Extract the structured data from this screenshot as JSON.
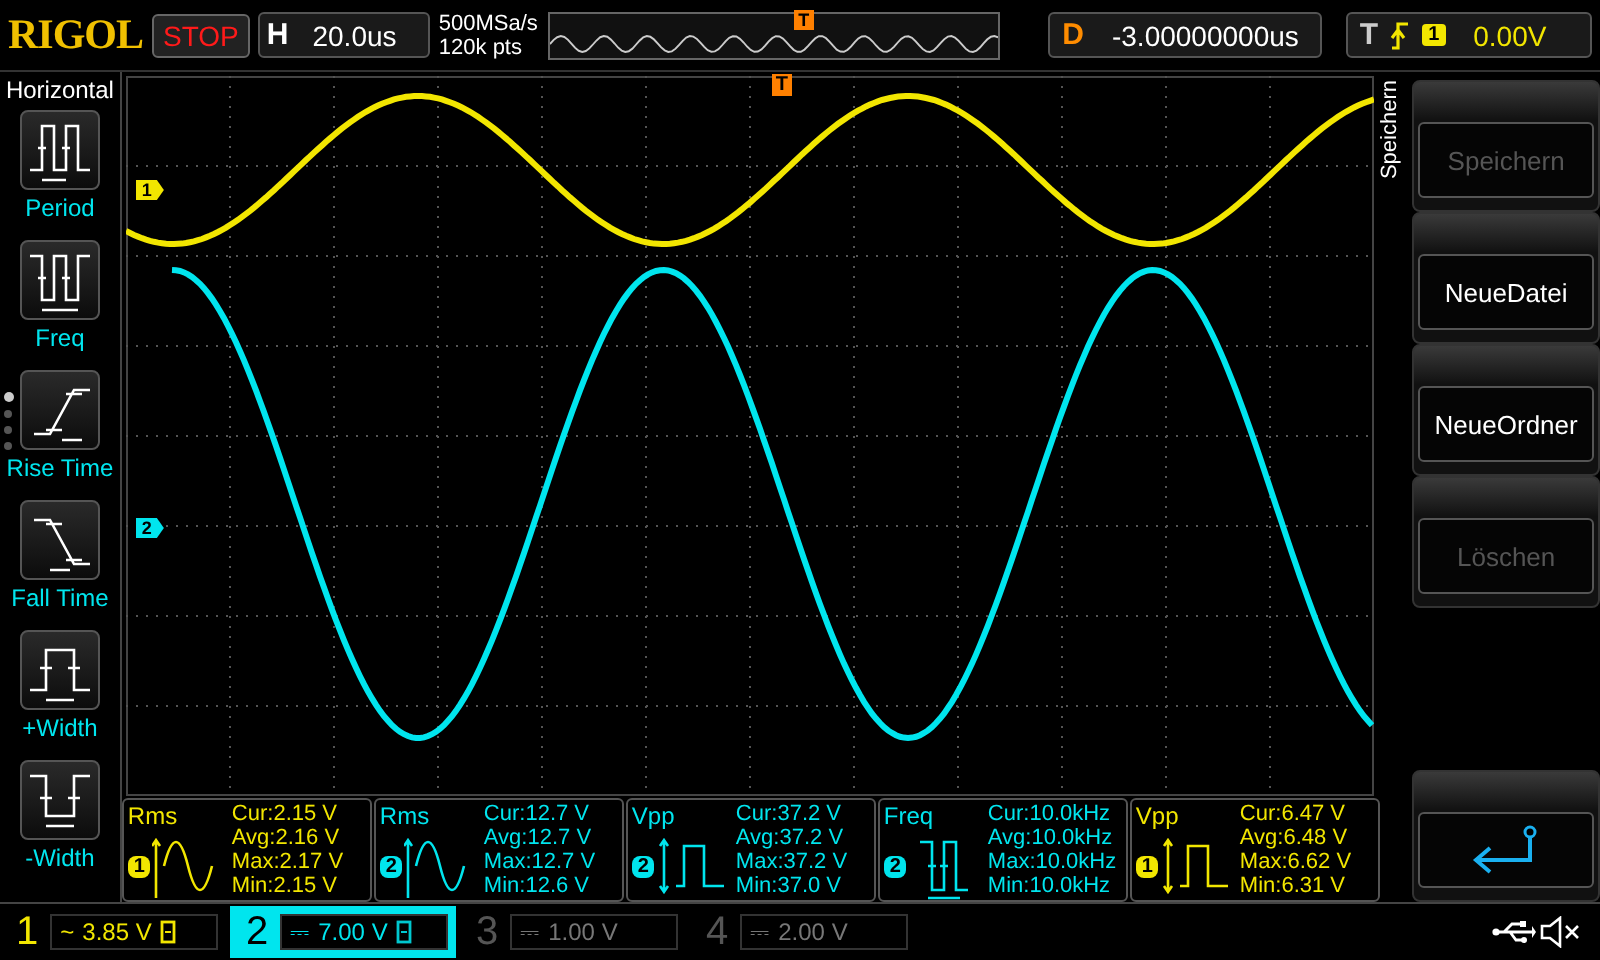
{
  "top_bar": {
    "logo": "RIGOL",
    "run_state": "STOP",
    "timebase": {
      "label": "H",
      "value": "20.0us"
    },
    "sample_rate": "500MSa/s",
    "memory_depth": "120k pts",
    "trigger_marker": "T",
    "delay": {
      "label": "D",
      "value": "-3.00000000us"
    },
    "trigger": {
      "label": "T",
      "source": "1",
      "level": "0.00V"
    }
  },
  "left_menu": {
    "title": "Horizontal",
    "page_dots": [
      {
        "selected": true
      },
      {
        "selected": false
      },
      {
        "selected": false
      },
      {
        "selected": false
      }
    ],
    "items": [
      {
        "kind": "period",
        "label": "Period"
      },
      {
        "kind": "freq",
        "label": "Freq"
      },
      {
        "kind": "rise",
        "label": "Rise Time"
      },
      {
        "kind": "fall",
        "label": "Fall Time"
      },
      {
        "kind": "pwidth",
        "label": "+Width"
      },
      {
        "kind": "nwidth",
        "label": "-Width"
      }
    ]
  },
  "screen": {
    "trigger_marker": "T",
    "channel_markers": [
      {
        "label": "1"
      },
      {
        "label": "2"
      }
    ]
  },
  "measurements": [
    {
      "name": "Rms",
      "channel": "1",
      "kind": "sine",
      "lines": [
        "Cur:2.15 V",
        "Avg:2.16 V",
        "Max:2.17 V",
        "Min:2.15 V"
      ]
    },
    {
      "name": "Rms",
      "channel": "2",
      "kind": "sine",
      "lines": [
        "Cur:12.7 V",
        "Avg:12.7 V",
        "Max:12.7 V",
        "Min:12.6 V"
      ]
    },
    {
      "name": "Vpp",
      "channel": "2",
      "kind": "vpp",
      "lines": [
        "Cur:37.2 V",
        "Avg:37.2 V",
        "Max:37.2 V",
        "Min:37.0 V"
      ]
    },
    {
      "name": "Freq",
      "channel": "2",
      "kind": "freq",
      "lines": [
        "Cur:10.0kHz",
        "Avg:10.0kHz",
        "Max:10.0kHz",
        "Min:10.0kHz"
      ]
    },
    {
      "name": "Vpp",
      "channel": "1",
      "kind": "vpp",
      "lines": [
        "Cur:6.47 V",
        "Avg:6.48 V",
        "Max:6.62 V",
        "Min:6.31 V"
      ]
    }
  ],
  "right_menu": {
    "title": "Speichern",
    "buttons": [
      {
        "kind": "text",
        "label": "Speichern",
        "disabled": true
      },
      {
        "kind": "text",
        "label": "NeueDatei",
        "disabled": false
      },
      {
        "kind": "text",
        "label": "NeueOrdner",
        "disabled": false
      },
      {
        "kind": "text",
        "label": "Löschen",
        "disabled": true
      },
      {
        "kind": "back"
      }
    ]
  },
  "channels": [
    {
      "number": "1",
      "on": true,
      "coupling": "~",
      "scale": "3.85 V",
      "bw_limit": true,
      "selected": false
    },
    {
      "number": "2",
      "on": true,
      "coupling": "⎓",
      "scale": "7.00 V",
      "bw_limit": true,
      "selected": true
    },
    {
      "number": "3",
      "on": false,
      "coupling": "⎓",
      "scale": "1.00 V",
      "bw_limit": false,
      "selected": false
    },
    {
      "number": "4",
      "on": false,
      "coupling": "⎓",
      "scale": "2.00 V",
      "bw_limit": false,
      "selected": false
    }
  ],
  "status": {
    "usb": true,
    "muted": true
  }
}
